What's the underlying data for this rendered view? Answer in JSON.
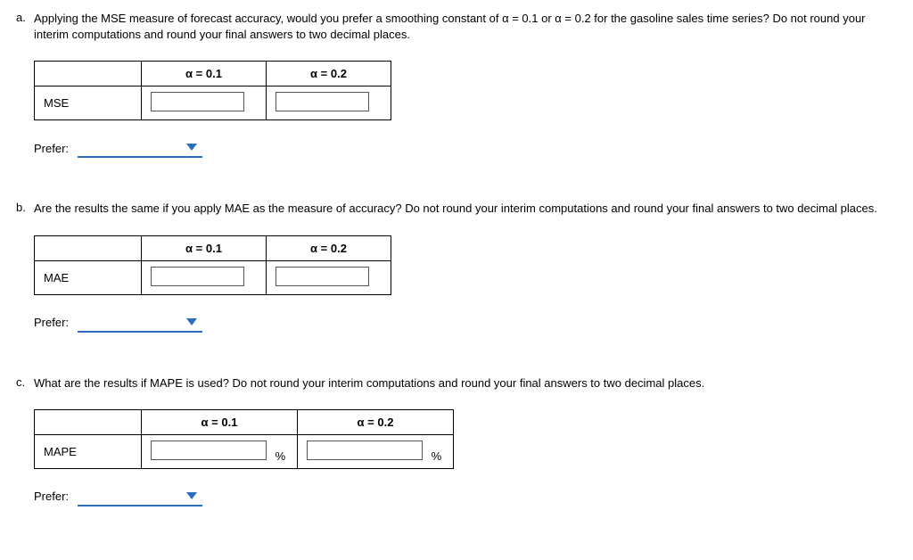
{
  "questions": {
    "a": {
      "marker": "a.",
      "text": "Applying the MSE measure of forecast accuracy, would you prefer a smoothing constant of α = 0.1 or α = 0.2 for the gasoline sales time series? Do not round your interim computations and round your final answers to two decimal places.",
      "row_label": "MSE",
      "header1": "α = 0.1",
      "header2": "α = 0.2",
      "prefer_label": "Prefer:"
    },
    "b": {
      "marker": "b.",
      "text": "Are the results the same if you apply MAE as the measure of accuracy? Do not round your interim computations and round your final answers to two decimal places.",
      "row_label": "MAE",
      "header1": "α = 0.1",
      "header2": "α = 0.2",
      "prefer_label": "Prefer:"
    },
    "c": {
      "marker": "c.",
      "text": "What are the results if MAPE is used? Do not round your interim computations and round your final answers to two decimal places.",
      "row_label": "MAPE",
      "header1": "α = 0.1",
      "header2": "α = 0.2",
      "prefer_label": "Prefer:",
      "pct": "%"
    }
  }
}
